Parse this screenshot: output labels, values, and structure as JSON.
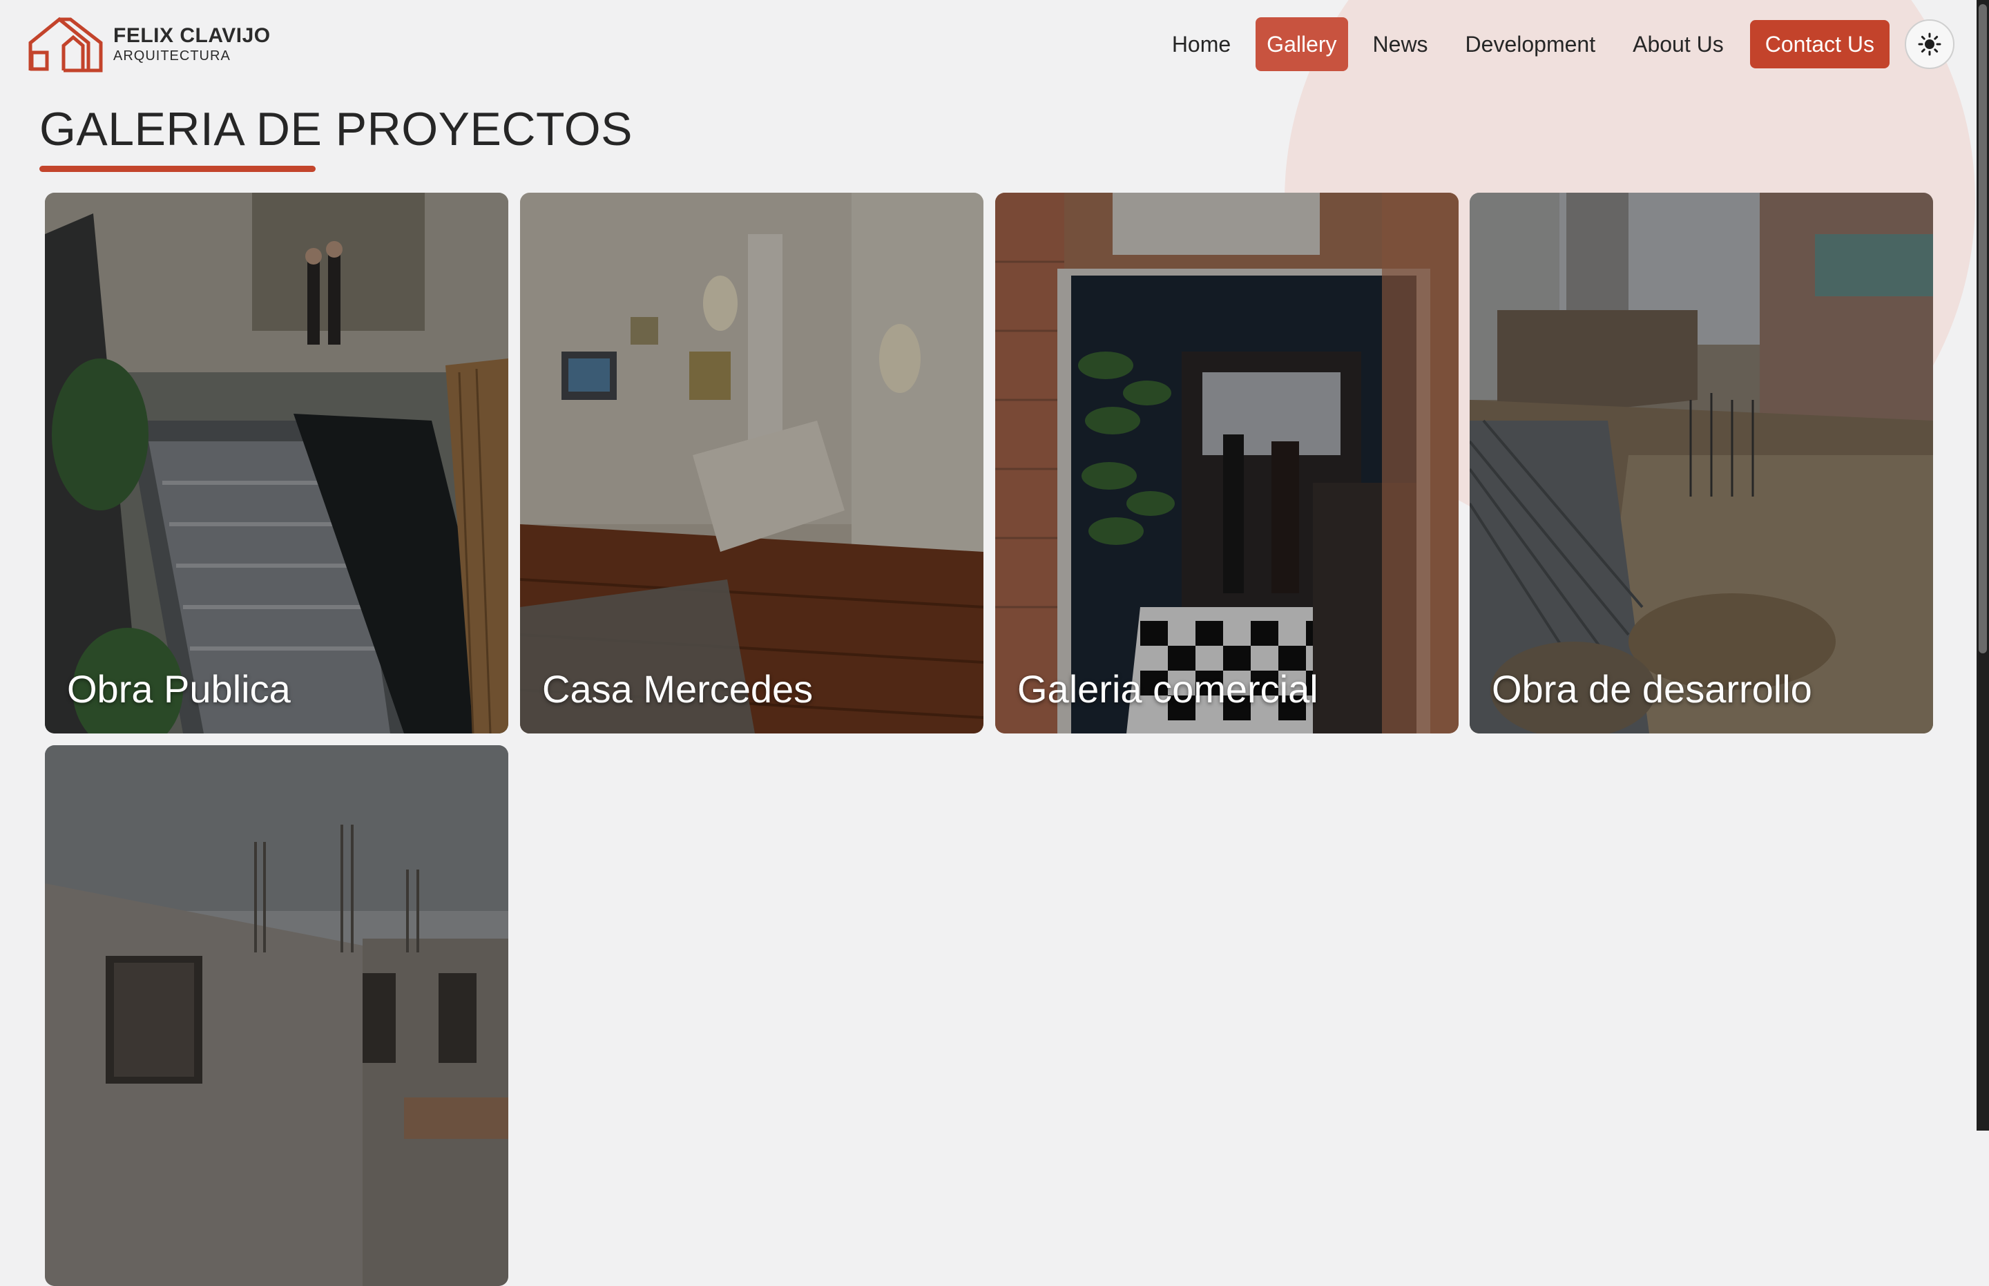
{
  "brand": {
    "name": "FELIX CLAVIJO",
    "tagline": "ARQUITECTURA",
    "accent": "#c3432b"
  },
  "nav": {
    "items": [
      {
        "label": "Home"
      },
      {
        "label": "Gallery",
        "active": true
      },
      {
        "label": "News"
      },
      {
        "label": "Development"
      },
      {
        "label": "About Us"
      }
    ],
    "cta": "Contact Us",
    "theme_icon": "sun-icon"
  },
  "page": {
    "title": "GALERIA DE PROYECTOS"
  },
  "gallery": {
    "cards": [
      {
        "label": "Obra Publica"
      },
      {
        "label": "Casa Mercedes"
      },
      {
        "label": "Galeria comercial"
      },
      {
        "label": "Obra de desarrollo"
      },
      {
        "label": ""
      }
    ]
  }
}
